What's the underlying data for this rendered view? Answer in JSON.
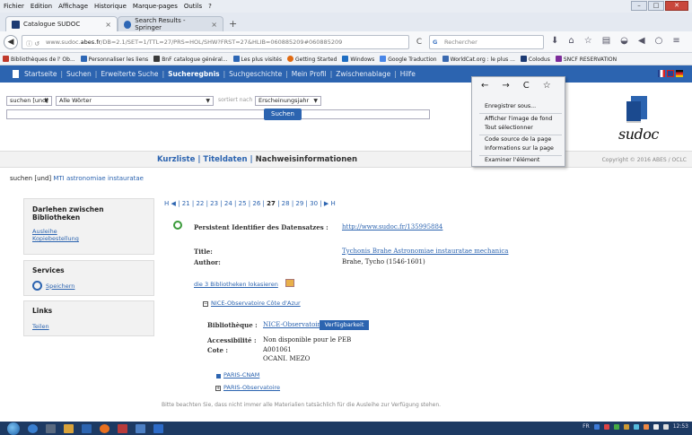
{
  "browser": {
    "menu": [
      "Fichier",
      "Edition",
      "Affichage",
      "Historique",
      "Marque-pages",
      "Outils",
      "?"
    ],
    "tabs": [
      {
        "label": "Catalogue SUDOC"
      },
      {
        "label": "Search Results - Springer"
      }
    ],
    "new_tab": "+",
    "url_prefix": "www.sudoc.",
    "url_domain": "abes.fr",
    "url_rest": "/DB=2.1/SET=1/TTL=27/PRS=HOL/SHW?FRST=27&HLIB=060885209#060885209",
    "search_placeholder": "Rechercher",
    "bookmarks": [
      {
        "label": "Bibliothèques de l' Ob...",
        "color": "#c0392b"
      },
      {
        "label": "Personnaliser les liens",
        "color": "#2e67b5"
      },
      {
        "label": "BnF catalogue général...",
        "color": "#3a3a3a"
      },
      {
        "label": "Les plus visités",
        "color": "#2e67b5"
      },
      {
        "label": "Getting Started",
        "color": "#e06a12"
      },
      {
        "label": "Windows",
        "color": "#1f6ec2"
      },
      {
        "label": "Google Traduction",
        "color": "#4a87e8"
      },
      {
        "label": "WorldCat.org : le plus ...",
        "color": "#3b6ab0"
      },
      {
        "label": "Colodus",
        "color": "#1c3a73"
      },
      {
        "label": "SNCF RESERVATION",
        "color": "#7c2b9a"
      }
    ]
  },
  "sudoc": {
    "top_nav": [
      "Startseite",
      "Suchen",
      "Erweiterte Suche",
      "Sucheregbnis",
      "Suchgeschichte",
      "Mein Profil",
      "Zwischenablage",
      "Hilfe"
    ],
    "search_mode": "suchen [und]",
    "search_field": "Alle Wörter",
    "sorted_label": "sortiert nach",
    "sort_value": "Erscheinungsjahr",
    "search_button": "Suchen",
    "logo_text": "sudoc",
    "tabs": [
      "Kurzliste",
      "Titeldaten",
      "Nachweisinformationen"
    ],
    "tab_sep": "|",
    "copyright": "Copyright © 2016 ABES / OCLC",
    "crumb_prefix": "suchen [und]",
    "crumb_link": "MTI astronomiae instauratae",
    "sidebar": {
      "loan_title_1": "Darlehen zwischen",
      "loan_title_2": "Bibliotheken",
      "loan_link": "Ausleihe",
      "copy_link": "Kopiebestellung",
      "services_title": "Services",
      "save_link": "Speichern",
      "links_title": "Links",
      "share_link": "Teilen"
    },
    "pager": {
      "first": "H",
      "prev": "◀",
      "pages_before": [
        "21",
        "22",
        "23",
        "24",
        "25",
        "26"
      ],
      "current": "27",
      "pages_after": [
        "28",
        "29",
        "30"
      ],
      "next": "▶",
      "last": "H"
    },
    "record": {
      "persistent_label": "Persistent Identifier des Datensatzes :",
      "persistent_url": "http://www.sudoc.fr/135995884",
      "title_label": "Title:",
      "title_value": "Tychonis Brahe Astronomiae instauratae mechanica",
      "author_label": "Author:",
      "author_value": "Brahe, Tycho (1546-1601)",
      "libraries_link": "die 3 Bibliotheken lokasieren",
      "lib1_header": "NICE-Observatoire Côte d'Azur",
      "bib_label": "Bibliothèque :",
      "bib_value": "NICE-Observatoire Côte d'Azur",
      "avail_button": "Verfügbarkeit",
      "access_label": "Accessibilité :",
      "access_value": "Non disponible pour le PEB",
      "cote_label": "Cote :",
      "cote_1": "A001061",
      "cote_2": "OCANI. MEZO",
      "lib2": "PARIS-CNAM",
      "lib3": "PARIS-Observatoire"
    },
    "footnote": "Bitte beachten Sie, dass nicht immer alle Materialien tatsächlich für die Ausleihe zur Verfügung stehen."
  },
  "context_menu": {
    "items": [
      "Enregistrer sous...",
      "Afficher l'image de fond",
      "Tout sélectionner",
      "Code source de la page",
      "Informations sur la page",
      "Examiner l'élément"
    ]
  },
  "taskbar": {
    "lang": "FR",
    "clock": "12:53"
  }
}
